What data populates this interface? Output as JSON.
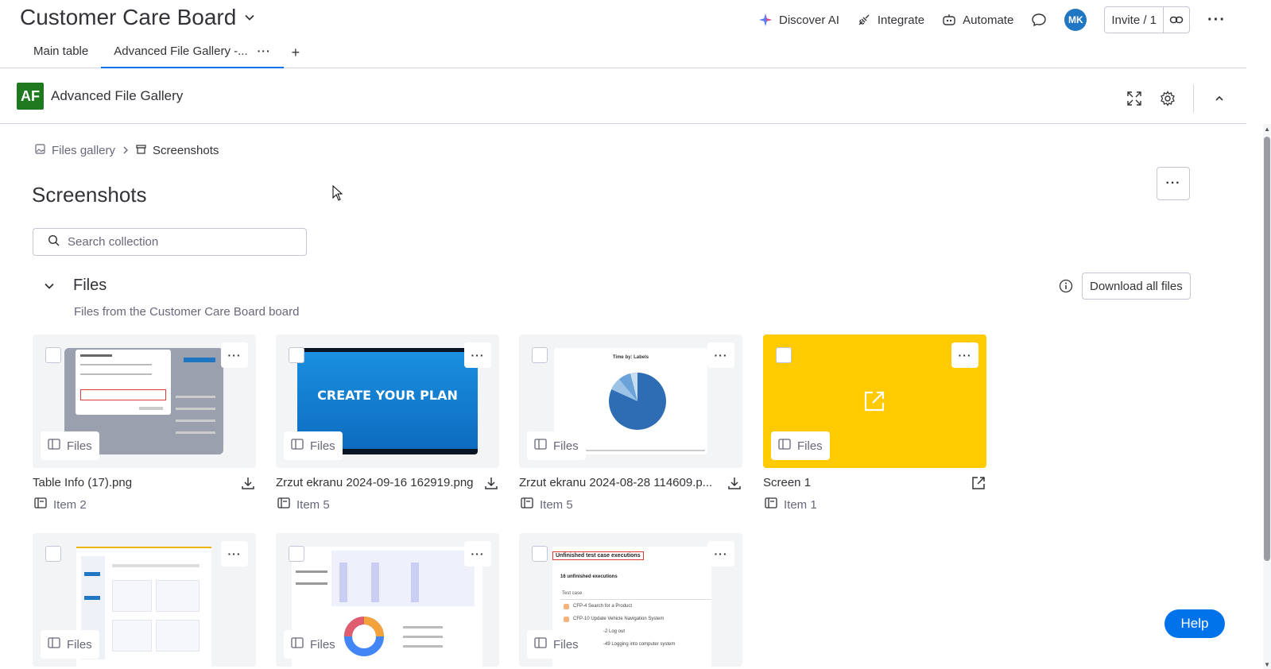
{
  "board": {
    "title": "Customer Care Board"
  },
  "actions": {
    "discover_ai": "Discover AI",
    "integrate": "Integrate",
    "automate": "Automate",
    "avatar_initials": "MK",
    "invite": "Invite / 1"
  },
  "tabs": [
    {
      "label": "Main table"
    },
    {
      "label": "Advanced File Gallery -..."
    }
  ],
  "app": {
    "logo": "AF",
    "name": "Advanced File Gallery"
  },
  "breadcrumb": {
    "root": "Files gallery",
    "current": "Screenshots"
  },
  "page": {
    "title": "Screenshots"
  },
  "search": {
    "placeholder": "Search collection"
  },
  "section": {
    "title": "Files",
    "subtitle": "Files from the Customer Care Board board",
    "download_all": "Download all files"
  },
  "cards": [
    {
      "name": "Table Info (17).png",
      "badge": "Files",
      "item": "Item 2",
      "action": "download-icon"
    },
    {
      "name": "Zrzut ekranu 2024-09-16 162919.png",
      "badge": "Files",
      "item": "Item 5",
      "action": "download-icon",
      "thumb_text": "CREATE YOUR PLAN"
    },
    {
      "name": "Zrzut ekranu 2024-08-28 114609.p...",
      "badge": "Files",
      "item": "Item 5",
      "action": "download-icon",
      "thumb_text": "Time by: Labels"
    },
    {
      "name": "Screen 1",
      "badge": "Files",
      "item": "Item 1",
      "action": "external-link-icon"
    },
    {
      "badge": "Files"
    },
    {
      "badge": "Files"
    },
    {
      "badge": "Files",
      "thumb_title": "Unfinished test case executions",
      "thumb_sub": "16 unfinished executions",
      "thumb_col": "Test case",
      "thumb_rows": [
        "CFP-4 Search for a Product",
        "CFP-10 Update Vehicle Navigation System",
        "-2 Log out",
        "-49 Logging into computer system"
      ]
    }
  ],
  "help": {
    "label": "Help"
  },
  "colors": {
    "accent": "#0073ea",
    "link_card": "#ffcb00",
    "logo": "#1f7a1f"
  }
}
